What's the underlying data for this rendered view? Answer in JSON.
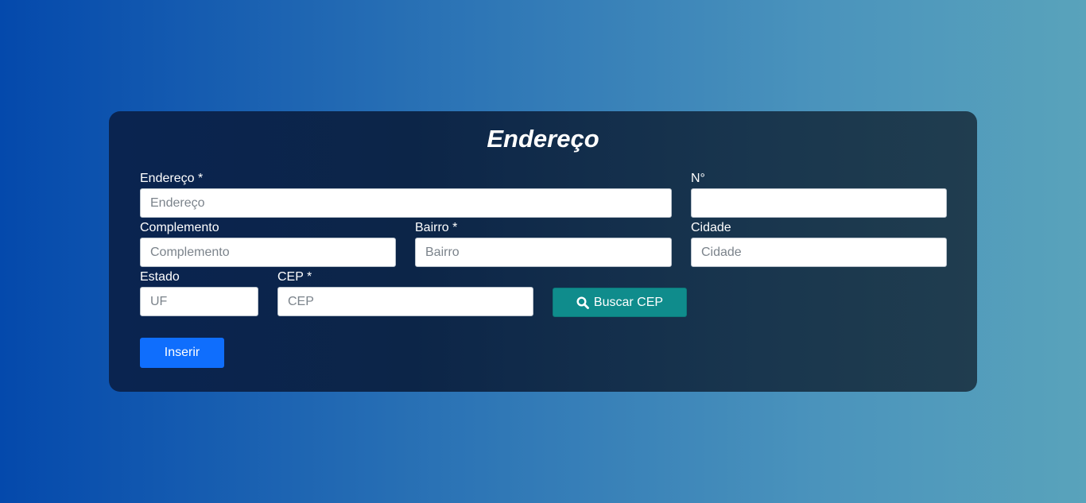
{
  "form": {
    "title": "Endereço",
    "fields": {
      "endereco": {
        "label": "Endereço *",
        "placeholder": "Endereço",
        "value": ""
      },
      "numero": {
        "label": "N°",
        "placeholder": "",
        "value": ""
      },
      "complemento": {
        "label": "Complemento",
        "placeholder": "Complemento",
        "value": ""
      },
      "bairro": {
        "label": "Bairro *",
        "placeholder": "Bairro",
        "value": ""
      },
      "cidade": {
        "label": "Cidade",
        "placeholder": "Cidade",
        "value": ""
      },
      "estado": {
        "label": "Estado",
        "placeholder": "UF",
        "value": ""
      },
      "cep": {
        "label": "CEP *",
        "placeholder": "CEP",
        "value": ""
      }
    },
    "buttons": {
      "search_label": "Buscar CEP",
      "search_icon": "search-icon",
      "insert_label": "Inserir"
    }
  },
  "colors": {
    "card_bg": "#0c2548",
    "search_button": "#0f8c8c",
    "insert_button": "#0f6efd"
  }
}
